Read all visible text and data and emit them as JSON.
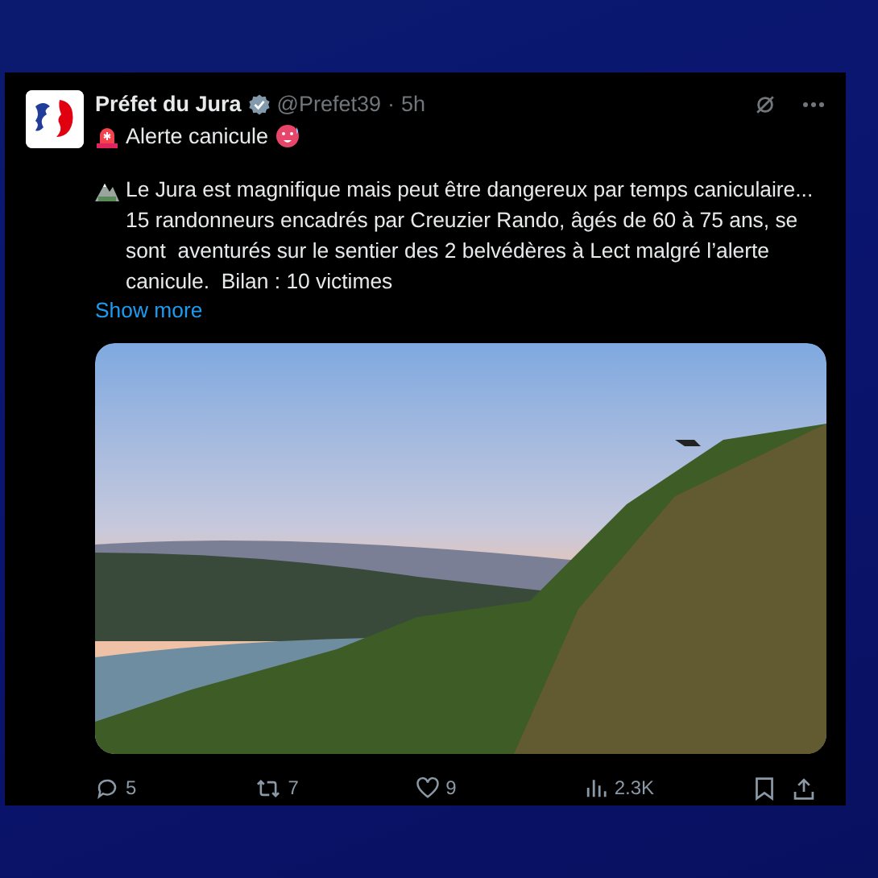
{
  "author": {
    "name": "Préfet du Jura",
    "verified": true,
    "handle": "@Prefet39",
    "separator": "·",
    "time": "5h"
  },
  "post": {
    "title": "Alerte canicule",
    "body": "Le Jura est magnifique mais peut être dangereux par temps caniculaire...  15 randonneurs encadrés par Creuzier Rando, âgés de 60 à 75 ans, se sont  aventurés sur le sentier des 2 belvédères à Lect malgré l’alerte  canicule.  Bilan : 10 victimes",
    "show_more": "Show more"
  },
  "actions": [
    {
      "kind": "reply",
      "count": "5"
    },
    {
      "kind": "repost",
      "count": "7"
    },
    {
      "kind": "like",
      "count": "9"
    },
    {
      "kind": "views",
      "count": "2.3K"
    },
    {
      "kind": "bookmark"
    },
    {
      "kind": "share"
    }
  ]
}
